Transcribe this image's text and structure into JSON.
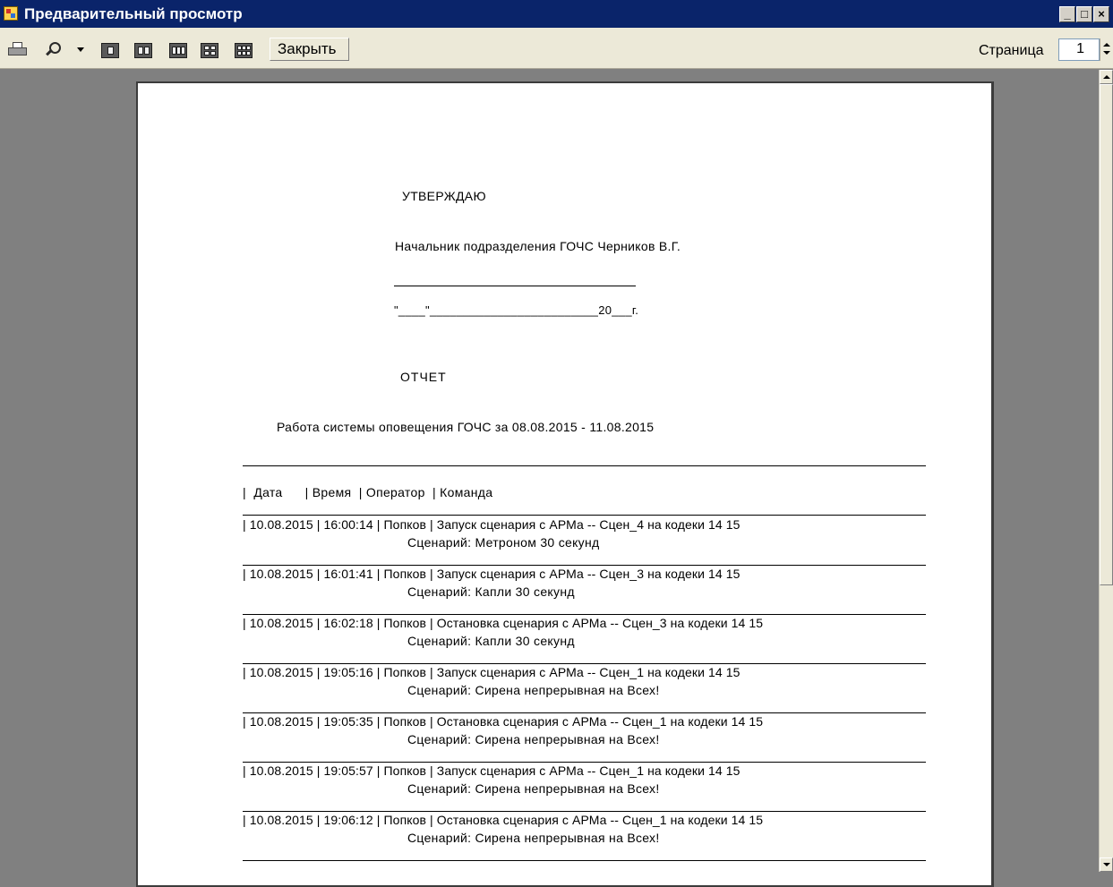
{
  "window": {
    "title": "Предварительный просмотр",
    "controls": [
      "_",
      "□",
      "×"
    ]
  },
  "toolbar": {
    "close_label": "Закрыть",
    "page_label": "Страница",
    "page_value": "1",
    "icons": [
      "printer-icon",
      "zoom-icon",
      "dropdown-arrow-icon",
      "one-page-icon",
      "two-pages-icon",
      "three-pages-icon",
      "four-pages-icon",
      "six-pages-icon"
    ]
  },
  "document": {
    "approve": "УТВЕРЖДАЮ",
    "chief": "Начальник подразделения ГОЧС Черников В.Г.",
    "date_line": "\"____\"_________________________20___г.",
    "report_title": "ОТЧЕТ",
    "report_subtitle": "Работа системы оповещения ГОЧС за 08.08.2015 - 11.08.2015",
    "table_header": "|  Дата      | Время  | Оператор  | Команда",
    "rows": [
      {
        "line1": "| 10.08.2015 | 16:00:14 | Попков | Запуск сценария с АРМа -- Сцен_4 на кодеки  14 15",
        "line2": "Сценарий: Метроном 30 секунд"
      },
      {
        "line1": "| 10.08.2015 | 16:01:41 | Попков | Запуск сценария с АРМа -- Сцен_3 на кодеки  14 15",
        "line2": "Сценарий: Капли 30 секунд"
      },
      {
        "line1": "| 10.08.2015 | 16:02:18 | Попков | Остановка сценария с АРМа -- Сцен_3 на кодеки  14 15",
        "line2": "Сценарий: Капли 30 секунд"
      },
      {
        "line1": "| 10.08.2015 | 19:05:16 | Попков | Запуск сценария с АРМа -- Сцен_1 на кодеки  14 15",
        "line2": "Сценарий: Сирена непрерывная на Всех!"
      },
      {
        "line1": "| 10.08.2015 | 19:05:35 | Попков | Остановка сценария с АРМа -- Сцен_1 на кодеки  14 15",
        "line2": "Сценарий: Сирена непрерывная на Всех!"
      },
      {
        "line1": "| 10.08.2015 | 19:05:57 | Попков | Запуск сценария с АРМа -- Сцен_1 на кодеки  14 15",
        "line2": "Сценарий: Сирена непрерывная на Всех!"
      },
      {
        "line1": "| 10.08.2015 | 19:06:12 | Попков | Остановка сценария с АРМа -- Сцен_1 на кодеки  14 15",
        "line2": "Сценарий: Сирена непрерывная на Всех!"
      }
    ]
  }
}
